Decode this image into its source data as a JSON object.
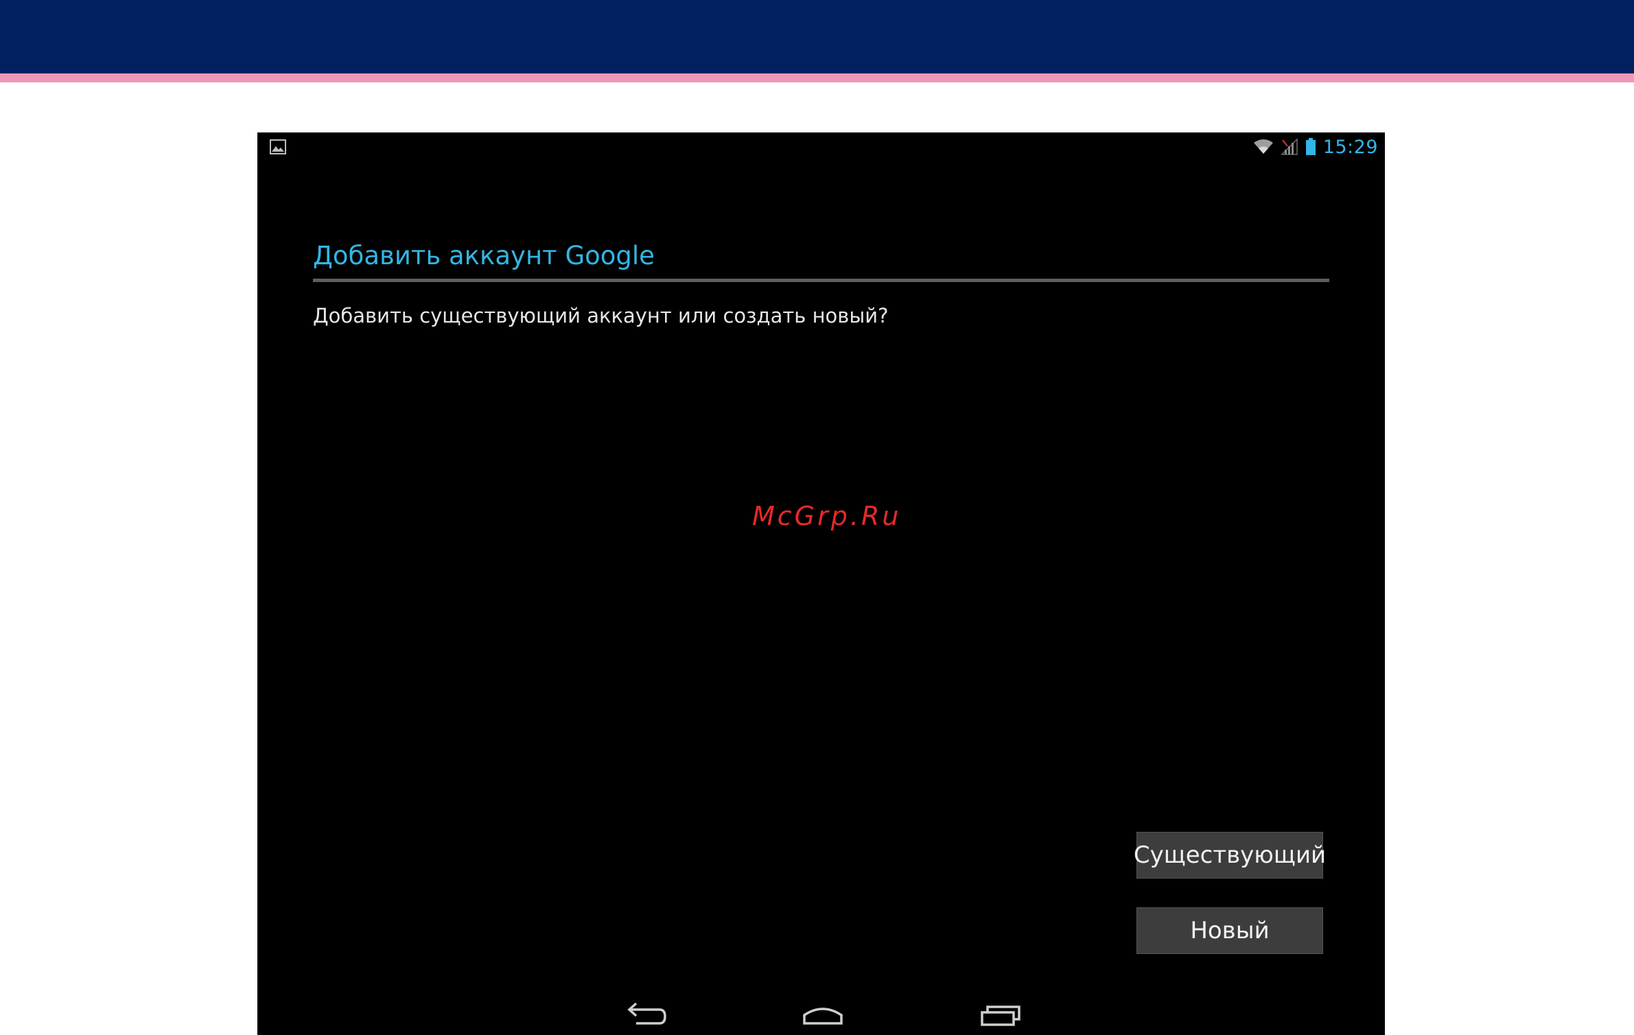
{
  "status_bar": {
    "time": "15:29",
    "icons": [
      "picture-icon",
      "wifi-icon",
      "signal-icon",
      "battery-icon"
    ]
  },
  "dialog": {
    "title": "Добавить аккаунт Google",
    "message": "Добавить существующий аккаунт или создать новый?",
    "buttons": {
      "existing": "Существующий",
      "new": "Новый"
    }
  },
  "watermark": "McGrp.Ru",
  "nav": [
    "back-icon",
    "home-icon",
    "recents-icon"
  ],
  "colors": {
    "header_band": "#00205f",
    "stripe": "#f197b5",
    "accent": "#33b5e5",
    "watermark": "#e52a2a"
  }
}
